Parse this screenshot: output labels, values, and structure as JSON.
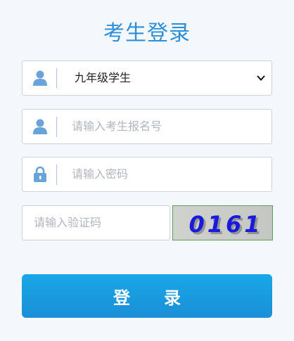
{
  "title": "考生登录",
  "grade_select": {
    "value": "九年级学生",
    "icon": "user-icon"
  },
  "exam_number": {
    "placeholder": "请输入考生报名号",
    "icon": "user-icon"
  },
  "password": {
    "placeholder": "请输入密码",
    "icon": "lock-icon"
  },
  "captcha": {
    "placeholder": "请输入验证码",
    "image_text": "0161"
  },
  "login_button": {
    "label": "登　　录"
  },
  "colors": {
    "accent": "#2d8fd9",
    "button": "#1a9ce0",
    "icon": "#6aa3d8"
  }
}
